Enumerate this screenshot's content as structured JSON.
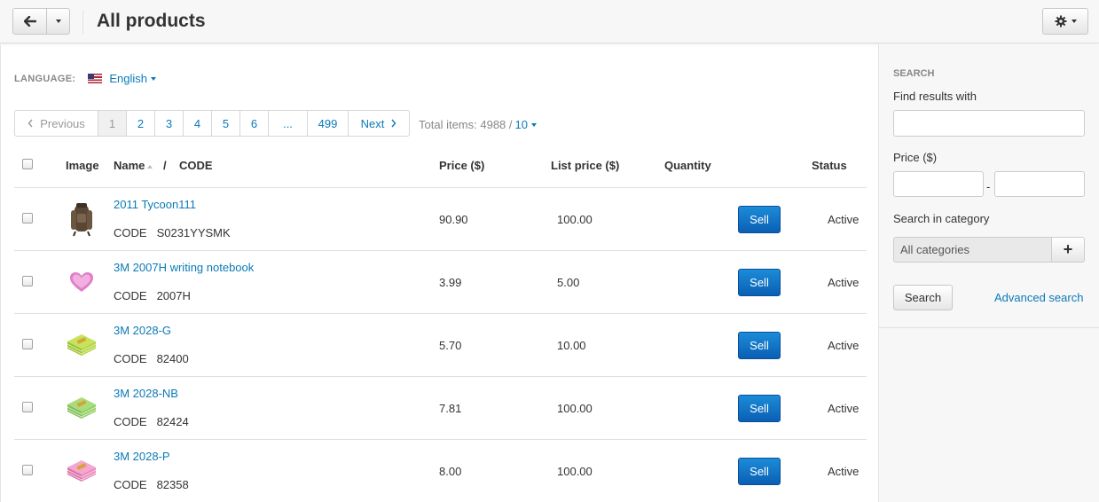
{
  "header": {
    "title": "All products",
    "back_icon": "arrow-left-icon",
    "settings_icon": "gear-icon"
  },
  "language": {
    "label": "LANGUAGE:",
    "value": "English",
    "flag_icon": "us-flag-icon"
  },
  "pagination": {
    "prev": "Previous",
    "pages": [
      "1",
      "2",
      "3",
      "4",
      "5",
      "6"
    ],
    "dots": "...",
    "last": "499",
    "next": "Next",
    "current_page": "1"
  },
  "totals": {
    "label": "Total items: 4988 /",
    "per_page": "10"
  },
  "table": {
    "columns": {
      "image": "Image",
      "name": "Name",
      "sep": "/",
      "code": "CODE",
      "price": "Price ($)",
      "list_price": "List price ($)",
      "quantity": "Quantity",
      "status": "Status"
    },
    "code_label": "CODE",
    "sell_label": "Sell",
    "rows": [
      {
        "name": "2011 Tycoon111",
        "code": "S0231YYSMK",
        "price": "90.90",
        "list_price": "100.00",
        "status": "Active",
        "thumb": "backpack"
      },
      {
        "name": "3M 2007H writing notebook",
        "code": "2007H",
        "price": "3.99",
        "list_price": "5.00",
        "status": "Active",
        "thumb": "heart-notes"
      },
      {
        "name": "3M 2028-G",
        "code": "82400",
        "price": "5.70",
        "list_price": "10.00",
        "status": "Active",
        "thumb": "green-notes"
      },
      {
        "name": "3M 2028-NB",
        "code": "82424",
        "price": "7.81",
        "list_price": "100.00",
        "status": "Active",
        "thumb": "green-notes"
      },
      {
        "name": "3M 2028-P",
        "code": "82358",
        "price": "8.00",
        "list_price": "100.00",
        "status": "Active",
        "thumb": "pink-notes"
      }
    ]
  },
  "sidebar": {
    "title": "SEARCH",
    "find_label": "Find results with",
    "find_value": "",
    "price_label": "Price ($)",
    "price_from": "",
    "price_to": "",
    "price_sep": "-",
    "category_label": "Search in category",
    "category_value": "All categories",
    "category_add": "+",
    "search_button": "Search",
    "advanced_link": "Advanced search"
  },
  "colors": {
    "link": "#0b7ab7",
    "sell_button": "#0a5fb4",
    "header_bg": "#f7f7f7"
  }
}
